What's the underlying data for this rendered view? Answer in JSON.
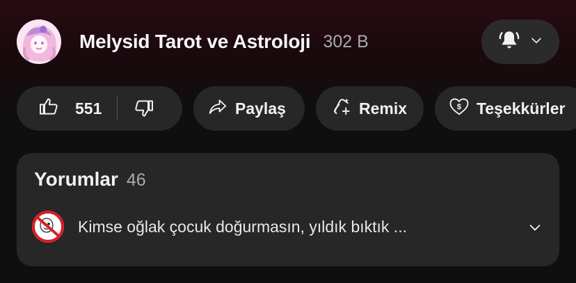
{
  "channel": {
    "name": "Melysid Tarot ve Astroloji",
    "subscribers": "302 B"
  },
  "actions": {
    "likes": "551",
    "share_label": "Paylaş",
    "remix_label": "Remix",
    "thanks_label": "Teşekkürler"
  },
  "comments": {
    "title": "Yorumlar",
    "count": "46",
    "top_comment": "Kimse oğlak çocuk doğurmasın, yıldık  bıktık ..."
  },
  "icons": {
    "notification": "bell-ringing-icon",
    "expand": "chevron-down-icon",
    "like": "thumbs-up-icon",
    "dislike": "thumbs-down-icon",
    "share": "share-arrow-icon",
    "remix": "remix-icon",
    "thanks": "heart-dollar-icon"
  },
  "colors": {
    "background": "#0f0f0f",
    "header_tint": "#2a0a12",
    "pill": "#272727",
    "text": "#f1f1f1",
    "muted": "#aaaaaa"
  }
}
